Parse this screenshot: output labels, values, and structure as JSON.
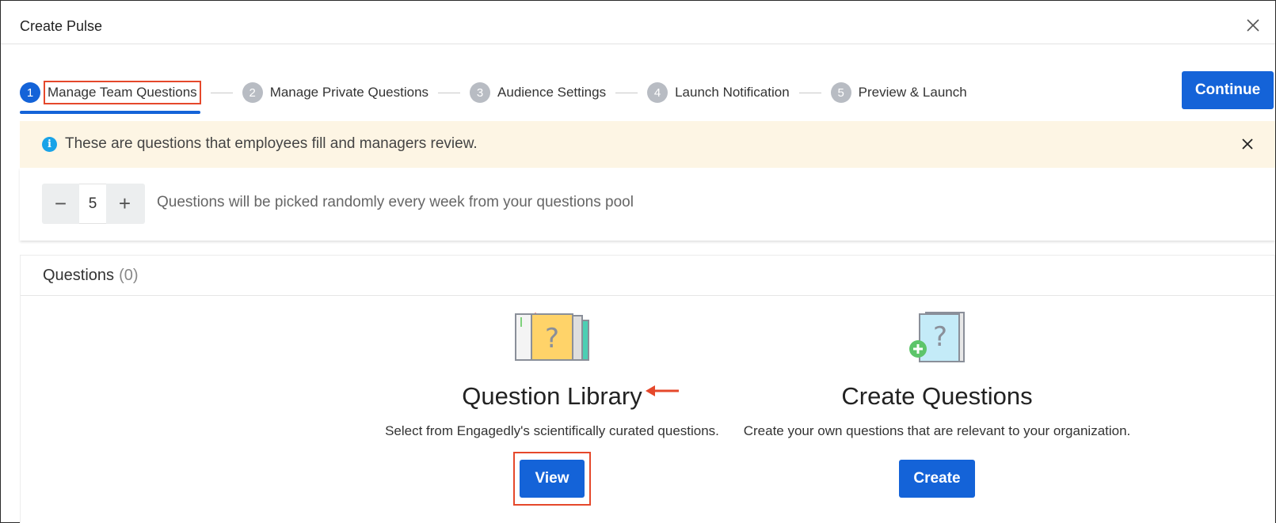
{
  "modal": {
    "title": "Create Pulse"
  },
  "steps": [
    {
      "num": "1",
      "label": "Manage Team Questions"
    },
    {
      "num": "2",
      "label": "Manage Private Questions"
    },
    {
      "num": "3",
      "label": "Audience Settings"
    },
    {
      "num": "4",
      "label": "Launch Notification"
    },
    {
      "num": "5",
      "label": "Preview & Launch"
    }
  ],
  "continue_label": "Continue",
  "banner": {
    "icon": "info-icon",
    "text": "These are questions that employees fill and managers review."
  },
  "question_count": {
    "value": "5",
    "decrement_symbol": "−",
    "increment_symbol": "+",
    "text": "Questions will be picked randomly every week from your questions pool"
  },
  "questions": {
    "title": "Questions",
    "count": "(0)",
    "library": {
      "title": "Question Library",
      "description": "Select from Engagedly's scientifically curated questions.",
      "button": "View"
    },
    "create": {
      "title": "Create Questions",
      "description": "Create your own questions that are relevant to your organization.",
      "button": "Create"
    }
  },
  "colors": {
    "primary": "#1463d8",
    "highlight": "#e5482b",
    "banner_bg": "#fdf5e4",
    "info": "#19a3e8"
  }
}
